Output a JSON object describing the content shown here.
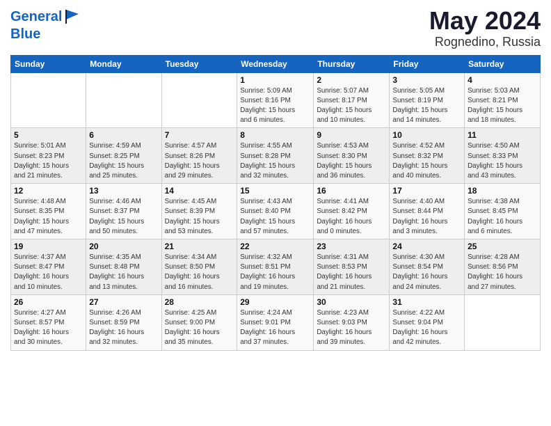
{
  "header": {
    "logo_line1": "General",
    "logo_line2": "Blue",
    "month": "May 2024",
    "location": "Rognedino, Russia"
  },
  "days_of_week": [
    "Sunday",
    "Monday",
    "Tuesday",
    "Wednesday",
    "Thursday",
    "Friday",
    "Saturday"
  ],
  "weeks": [
    [
      {
        "day": "",
        "info": ""
      },
      {
        "day": "",
        "info": ""
      },
      {
        "day": "",
        "info": ""
      },
      {
        "day": "1",
        "info": "Sunrise: 5:09 AM\nSunset: 8:16 PM\nDaylight: 15 hours\nand 6 minutes."
      },
      {
        "day": "2",
        "info": "Sunrise: 5:07 AM\nSunset: 8:17 PM\nDaylight: 15 hours\nand 10 minutes."
      },
      {
        "day": "3",
        "info": "Sunrise: 5:05 AM\nSunset: 8:19 PM\nDaylight: 15 hours\nand 14 minutes."
      },
      {
        "day": "4",
        "info": "Sunrise: 5:03 AM\nSunset: 8:21 PM\nDaylight: 15 hours\nand 18 minutes."
      }
    ],
    [
      {
        "day": "5",
        "info": "Sunrise: 5:01 AM\nSunset: 8:23 PM\nDaylight: 15 hours\nand 21 minutes."
      },
      {
        "day": "6",
        "info": "Sunrise: 4:59 AM\nSunset: 8:25 PM\nDaylight: 15 hours\nand 25 minutes."
      },
      {
        "day": "7",
        "info": "Sunrise: 4:57 AM\nSunset: 8:26 PM\nDaylight: 15 hours\nand 29 minutes."
      },
      {
        "day": "8",
        "info": "Sunrise: 4:55 AM\nSunset: 8:28 PM\nDaylight: 15 hours\nand 32 minutes."
      },
      {
        "day": "9",
        "info": "Sunrise: 4:53 AM\nSunset: 8:30 PM\nDaylight: 15 hours\nand 36 minutes."
      },
      {
        "day": "10",
        "info": "Sunrise: 4:52 AM\nSunset: 8:32 PM\nDaylight: 15 hours\nand 40 minutes."
      },
      {
        "day": "11",
        "info": "Sunrise: 4:50 AM\nSunset: 8:33 PM\nDaylight: 15 hours\nand 43 minutes."
      }
    ],
    [
      {
        "day": "12",
        "info": "Sunrise: 4:48 AM\nSunset: 8:35 PM\nDaylight: 15 hours\nand 47 minutes."
      },
      {
        "day": "13",
        "info": "Sunrise: 4:46 AM\nSunset: 8:37 PM\nDaylight: 15 hours\nand 50 minutes."
      },
      {
        "day": "14",
        "info": "Sunrise: 4:45 AM\nSunset: 8:39 PM\nDaylight: 15 hours\nand 53 minutes."
      },
      {
        "day": "15",
        "info": "Sunrise: 4:43 AM\nSunset: 8:40 PM\nDaylight: 15 hours\nand 57 minutes."
      },
      {
        "day": "16",
        "info": "Sunrise: 4:41 AM\nSunset: 8:42 PM\nDaylight: 16 hours\nand 0 minutes."
      },
      {
        "day": "17",
        "info": "Sunrise: 4:40 AM\nSunset: 8:44 PM\nDaylight: 16 hours\nand 3 minutes."
      },
      {
        "day": "18",
        "info": "Sunrise: 4:38 AM\nSunset: 8:45 PM\nDaylight: 16 hours\nand 6 minutes."
      }
    ],
    [
      {
        "day": "19",
        "info": "Sunrise: 4:37 AM\nSunset: 8:47 PM\nDaylight: 16 hours\nand 10 minutes."
      },
      {
        "day": "20",
        "info": "Sunrise: 4:35 AM\nSunset: 8:48 PM\nDaylight: 16 hours\nand 13 minutes."
      },
      {
        "day": "21",
        "info": "Sunrise: 4:34 AM\nSunset: 8:50 PM\nDaylight: 16 hours\nand 16 minutes."
      },
      {
        "day": "22",
        "info": "Sunrise: 4:32 AM\nSunset: 8:51 PM\nDaylight: 16 hours\nand 19 minutes."
      },
      {
        "day": "23",
        "info": "Sunrise: 4:31 AM\nSunset: 8:53 PM\nDaylight: 16 hours\nand 21 minutes."
      },
      {
        "day": "24",
        "info": "Sunrise: 4:30 AM\nSunset: 8:54 PM\nDaylight: 16 hours\nand 24 minutes."
      },
      {
        "day": "25",
        "info": "Sunrise: 4:28 AM\nSunset: 8:56 PM\nDaylight: 16 hours\nand 27 minutes."
      }
    ],
    [
      {
        "day": "26",
        "info": "Sunrise: 4:27 AM\nSunset: 8:57 PM\nDaylight: 16 hours\nand 30 minutes."
      },
      {
        "day": "27",
        "info": "Sunrise: 4:26 AM\nSunset: 8:59 PM\nDaylight: 16 hours\nand 32 minutes."
      },
      {
        "day": "28",
        "info": "Sunrise: 4:25 AM\nSunset: 9:00 PM\nDaylight: 16 hours\nand 35 minutes."
      },
      {
        "day": "29",
        "info": "Sunrise: 4:24 AM\nSunset: 9:01 PM\nDaylight: 16 hours\nand 37 minutes."
      },
      {
        "day": "30",
        "info": "Sunrise: 4:23 AM\nSunset: 9:03 PM\nDaylight: 16 hours\nand 39 minutes."
      },
      {
        "day": "31",
        "info": "Sunrise: 4:22 AM\nSunset: 9:04 PM\nDaylight: 16 hours\nand 42 minutes."
      },
      {
        "day": "",
        "info": ""
      }
    ]
  ]
}
